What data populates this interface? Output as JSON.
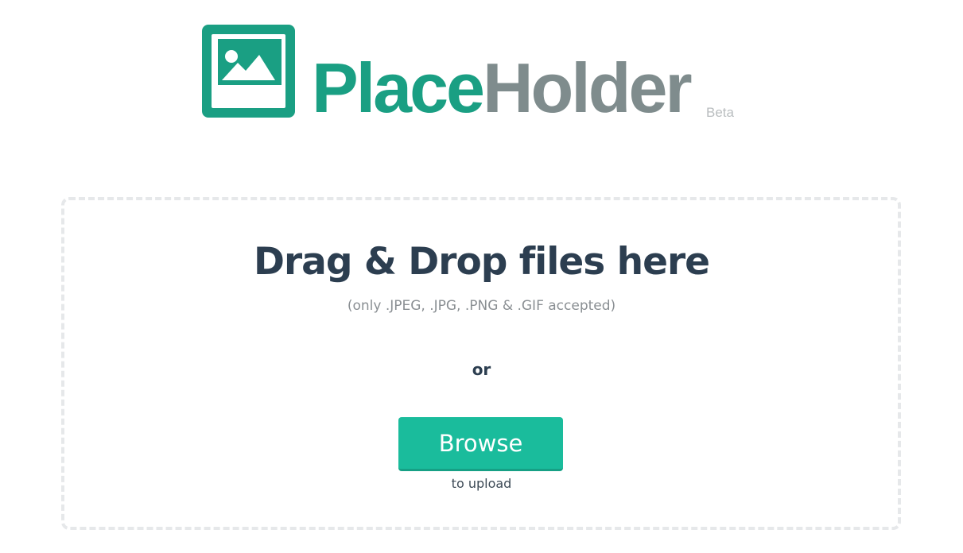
{
  "brand": {
    "name_part1": "Place",
    "name_part2": "Holder",
    "badge": "Beta",
    "icon": "image-icon",
    "colors": {
      "primary": "#1a9f83",
      "secondary": "#7f8c8d",
      "badge": "#b9bdbf"
    }
  },
  "dropzone": {
    "title": "Drag & Drop files here",
    "subtitle": "(only .JPEG, .JPG, .PNG & .GIF accepted)",
    "separator": "or",
    "browse_label": "Browse",
    "upload_hint": "to upload",
    "colors": {
      "button": "#1abc9c",
      "title": "#2c3e50",
      "border": "#e6e8ea"
    }
  }
}
